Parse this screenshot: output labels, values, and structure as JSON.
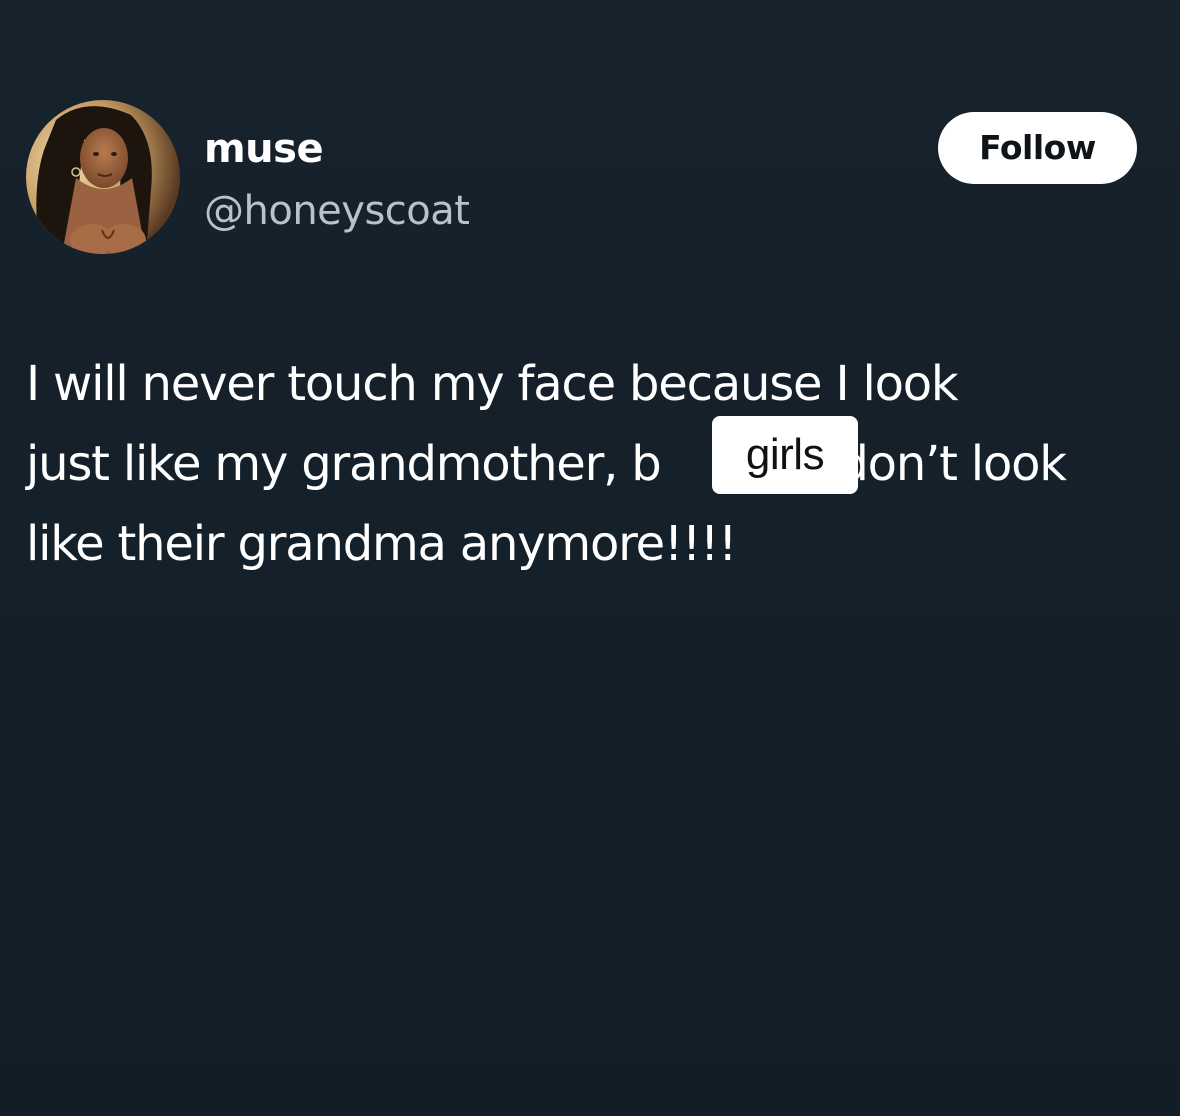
{
  "tweet": {
    "author": {
      "display_name": "muse",
      "handle": "@honeyscoat",
      "avatar_icon": "profile-photo"
    },
    "follow_label": "Follow",
    "text_lines": [
      "I will never touch my face because I look",
      "just like my grandmother, b",
      "like their grandma anymore!!!!"
    ],
    "text_line2_tail": "s don’t look"
  },
  "overlay": {
    "sticker_text": "girls"
  },
  "colors": {
    "background": "#15202b",
    "text": "#ffffff",
    "secondary_text": "#b9c2ca",
    "button_bg": "#ffffff",
    "button_text": "#0f1419"
  }
}
